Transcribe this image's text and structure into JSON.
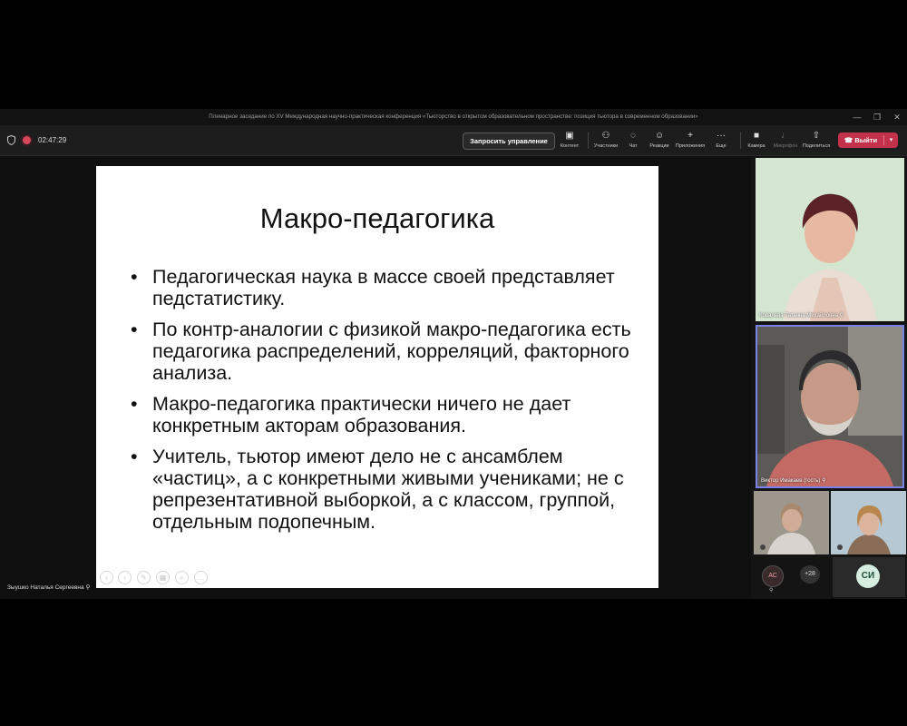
{
  "window": {
    "title": "Пленарное заседание по XV Международная научно-практическая конференция «Тьюторство в открытом образовательном пространстве: позиция тьютора в современном образовании»",
    "minimize": "—",
    "maximize": "❐",
    "close": "✕"
  },
  "toolbar": {
    "timer": "02:47:29",
    "request_control": "Запросить управление",
    "buttons": [
      {
        "label": "Контент",
        "icon": "share-screen-icon"
      },
      {
        "label": "Участники",
        "icon": "people-icon"
      },
      {
        "label": "Чат",
        "icon": "chat-icon"
      },
      {
        "label": "Реакции",
        "icon": "reactions-icon"
      },
      {
        "label": "Приложения",
        "icon": "plus-icon"
      },
      {
        "label": "Еще",
        "icon": "more-icon"
      },
      {
        "label": "Камера",
        "icon": "camera-icon"
      },
      {
        "label": "Микрофон",
        "icon": "mic-off-icon"
      },
      {
        "label": "Поделиться",
        "icon": "share-icon"
      }
    ],
    "leave": "Выйти"
  },
  "slide": {
    "title": "Макро-педагогика",
    "bullets": [
      "Педагогическая наука в массе своей представляет педстатистику.",
      "По контр-аналогии с физикой макро-педагогика есть педагогика распределений, корреляций, факторного анализа.",
      "Макро-педагогика практически ничего не дает конкретным акторам образования.",
      "Учитель, тьютор имеют дело не с ансамблем «частиц», а с конкретными живыми учениками;  не с репрезентативной выборкой, а с классом, группой, отдельным подопечным."
    ]
  },
  "presenter": {
    "name": "Зыушко Наталья Сергеевна"
  },
  "participants": [
    {
      "name": "Ковалева Татьяна Михайловна"
    },
    {
      "name": "Виктор Имакаев (гость)"
    }
  ],
  "roster": {
    "avatar_as": "АС",
    "more_count": "+28",
    "avatar_si": "СИ"
  },
  "colors": {
    "leave": "#c4314b",
    "active_speaker_border": "#7b83eb",
    "record": "#d9465a"
  }
}
